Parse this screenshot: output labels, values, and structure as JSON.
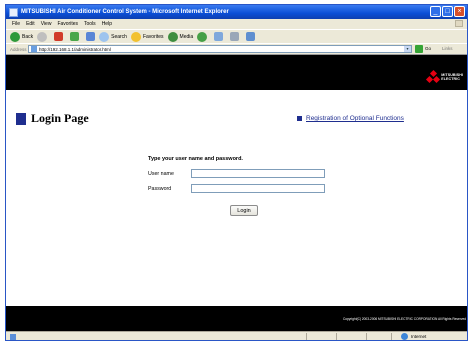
{
  "window": {
    "title": "MITSUBISHI Air Conditioner Control System - Microsoft Internet Explorer",
    "min_label": "_",
    "max_label": "□",
    "close_label": "×"
  },
  "menu": [
    "File",
    "Edit",
    "View",
    "Favorites",
    "Tools",
    "Help"
  ],
  "toolbar": {
    "back_label": "Back",
    "search_label": "Search",
    "favorites_label": "Favorites",
    "media_label": "Media"
  },
  "address": {
    "label": "Address",
    "url": "http://192.168.1.1/administrator.html",
    "go_label": "Go",
    "links_label": "Links"
  },
  "header": {
    "brand_line1": "MITSUBISHI",
    "brand_line2": "ELECTRIC"
  },
  "page": {
    "title": "Login Page",
    "registration_link": "Registration of Optional Functions",
    "prompt": "Type your user name and password.",
    "username_label": "User name",
    "password_label": "Password",
    "username_value": "",
    "password_value": "",
    "login_button": "Login"
  },
  "footer": {
    "copyright": "Copyright(C) 2003-2006 MITSUBISHI ELECTRIC CORPORATION All Rights Reserved"
  },
  "status": {
    "zone": "Internet"
  },
  "colors": {
    "title_bar": "#0a4ed6",
    "band": "#000000",
    "accent_square": "#1f2e8f",
    "logo_red": "#e60012"
  }
}
